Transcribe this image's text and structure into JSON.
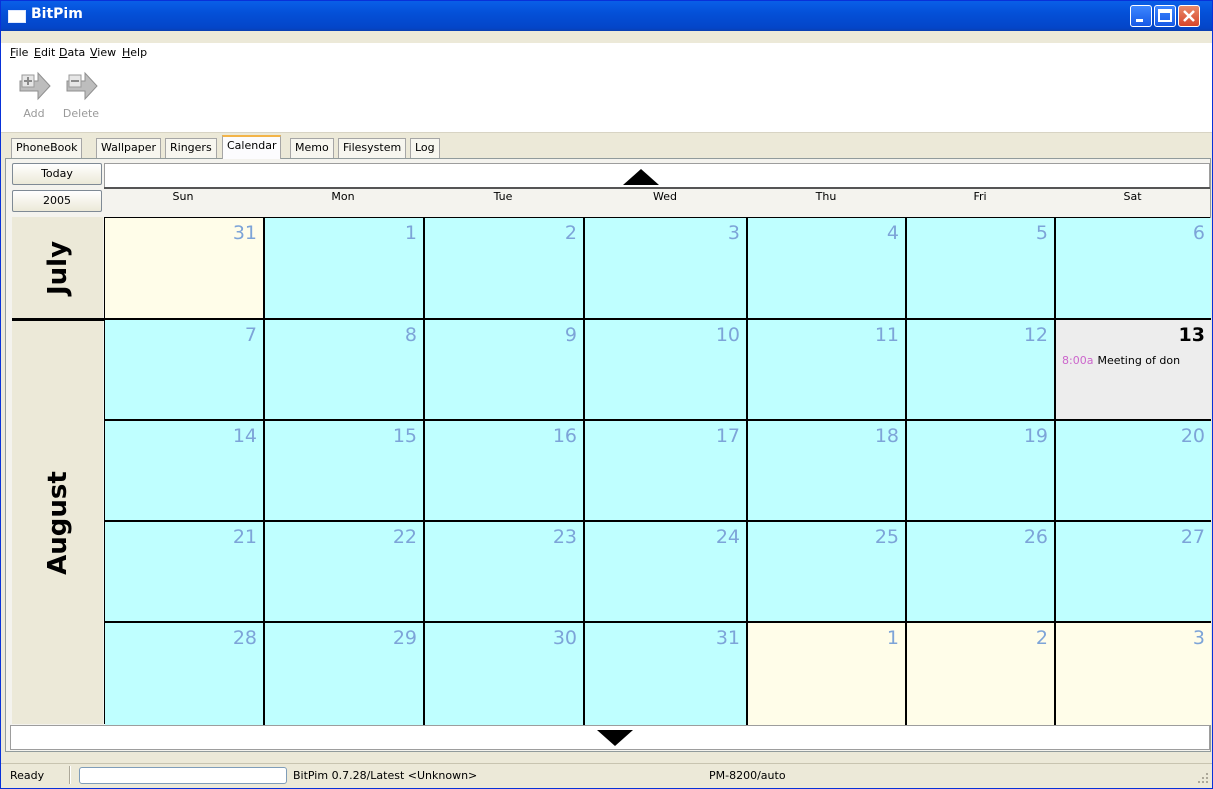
{
  "window": {
    "title": "BitPim"
  },
  "menu": [
    {
      "id": "file",
      "label": "File"
    },
    {
      "id": "edit",
      "label": "Edit"
    },
    {
      "id": "data",
      "label": "Data"
    },
    {
      "id": "view",
      "label": "View"
    },
    {
      "id": "help",
      "label": "Help"
    }
  ],
  "toolbar": {
    "add_label": "Add",
    "delete_label": "Delete"
  },
  "tabs": [
    "PhoneBook",
    "Wallpaper",
    "Ringers",
    "Calendar",
    "Memo",
    "Filesystem",
    "Log"
  ],
  "active_tab": "Calendar",
  "calendar": {
    "today_button": "Today",
    "year_button": "2005",
    "weekdays": [
      "Sun",
      "Mon",
      "Tue",
      "Wed",
      "Thu",
      "Fri",
      "Sat"
    ],
    "months": [
      {
        "label": "July"
      },
      {
        "label": "August"
      }
    ],
    "weeks": [
      [
        {
          "day": "31",
          "kind": "other"
        },
        {
          "day": "1",
          "kind": "in"
        },
        {
          "day": "2",
          "kind": "in"
        },
        {
          "day": "3",
          "kind": "in"
        },
        {
          "day": "4",
          "kind": "in"
        },
        {
          "day": "5",
          "kind": "in"
        },
        {
          "day": "6",
          "kind": "in"
        }
      ],
      [
        {
          "day": "7",
          "kind": "in"
        },
        {
          "day": "8",
          "kind": "in"
        },
        {
          "day": "9",
          "kind": "in"
        },
        {
          "day": "10",
          "kind": "in"
        },
        {
          "day": "11",
          "kind": "in"
        },
        {
          "day": "12",
          "kind": "in"
        },
        {
          "day": "13",
          "kind": "today",
          "event_time": "8:00a",
          "event_title": "Meeting of don"
        }
      ],
      [
        {
          "day": "14",
          "kind": "in"
        },
        {
          "day": "15",
          "kind": "in"
        },
        {
          "day": "16",
          "kind": "in"
        },
        {
          "day": "17",
          "kind": "in"
        },
        {
          "day": "18",
          "kind": "in"
        },
        {
          "day": "19",
          "kind": "in"
        },
        {
          "day": "20",
          "kind": "in"
        }
      ],
      [
        {
          "day": "21",
          "kind": "in"
        },
        {
          "day": "22",
          "kind": "in"
        },
        {
          "day": "23",
          "kind": "in"
        },
        {
          "day": "24",
          "kind": "in"
        },
        {
          "day": "25",
          "kind": "in"
        },
        {
          "day": "26",
          "kind": "in"
        },
        {
          "day": "27",
          "kind": "in"
        }
      ],
      [
        {
          "day": "28",
          "kind": "in"
        },
        {
          "day": "29",
          "kind": "in"
        },
        {
          "day": "30",
          "kind": "in"
        },
        {
          "day": "31",
          "kind": "in"
        },
        {
          "day": "1",
          "kind": "other"
        },
        {
          "day": "2",
          "kind": "other"
        },
        {
          "day": "3",
          "kind": "other"
        }
      ]
    ]
  },
  "status": {
    "ready": "Ready",
    "version": "BitPim 0.7.28/Latest <Unknown>",
    "phone": "PM-8200/auto"
  },
  "colors": {
    "cell_in_month": "#bfffff",
    "cell_other_month": "#fffde9",
    "cell_today": "#ededed",
    "day_number": "#7da4d8",
    "event_time": "#cc66cc",
    "titlebar": "#0450d8"
  }
}
